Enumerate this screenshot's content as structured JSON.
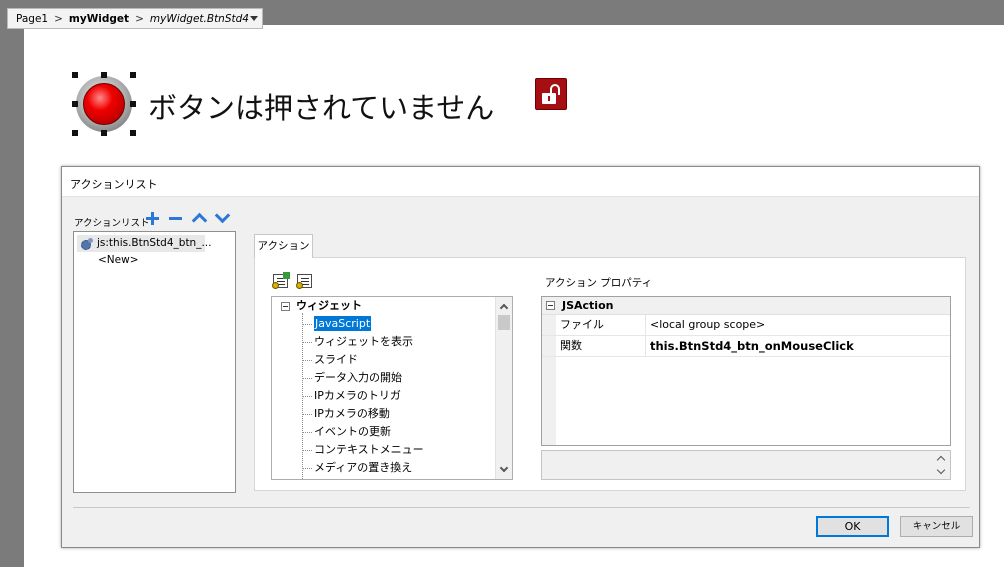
{
  "breadcrumb": {
    "page": "Page1",
    "widget": "myWidget",
    "path": "myWidget.BtnStd4"
  },
  "canvas": {
    "widget_text": "ボタンは押されていません",
    "lock_icon": "unlocked-padlock-icon",
    "lock_color": "#a50f14"
  },
  "dialog": {
    "title": "アクションリスト",
    "list_label": "アクションリスト",
    "toolbar_icons": [
      "plus-icon",
      "minus-icon",
      "arrow-up-icon",
      "arrow-down-icon"
    ],
    "actions": [
      {
        "label": "js:this.BtnStd4_btn_..."
      },
      {
        "label": "<New>"
      }
    ],
    "tab_label": "アクション",
    "tree": {
      "category": "ウィジェット",
      "items": [
        "JavaScript",
        "ウィジェットを表示",
        "スライド",
        "データ入力の開始",
        "IPカメラのトリガ",
        "IPカメラの移動",
        "イベントの更新",
        "コンテキストメニュー",
        "メディアの置き換え"
      ],
      "selected": "JavaScript"
    },
    "properties": {
      "title": "アクション プロパティ",
      "category": "JSAction",
      "rows": [
        {
          "name": "ファイル",
          "value": "<local group scope>"
        },
        {
          "name": "関数",
          "value": "this.BtnStd4_btn_onMouseClick"
        }
      ]
    },
    "ok_label": "OK",
    "cancel_label": "キャンセル",
    "accent_color": "#0078d7"
  }
}
